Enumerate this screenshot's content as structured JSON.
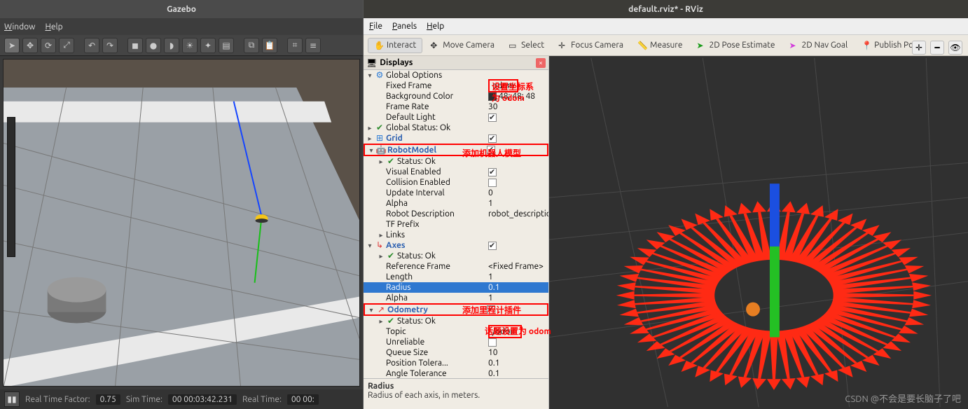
{
  "gazebo": {
    "title": "Gazebo",
    "menu": {
      "window": "Window",
      "help": "Help"
    },
    "status": {
      "rtf_label": "Real Time Factor:",
      "rtf_value": "0.75",
      "simtime_label": "Sim Time:",
      "simtime_value": "00 00:03:42.231",
      "realtime_label": "Real Time:",
      "realtime_value": "00 00:"
    }
  },
  "rviz": {
    "title": "default.rviz* - RViz",
    "menu": {
      "file": "File",
      "panels": "Panels",
      "help": "Help"
    },
    "toolbar": {
      "interact": "Interact",
      "move_camera": "Move Camera",
      "select": "Select",
      "focus_camera": "Focus Camera",
      "measure": "Measure",
      "pose_estimate": "2D Pose Estimate",
      "nav_goal": "2D Nav Goal",
      "publish_point": "Publish Point"
    },
    "panel_title": "Displays",
    "tree": {
      "global_options": "Global Options",
      "fixed_frame": "Fixed Frame",
      "fixed_frame_v": "odom",
      "bg_color": "Background Color",
      "bg_color_v": "48; 48; 48",
      "frame_rate": "Frame Rate",
      "frame_rate_v": "30",
      "default_light": "Default Light",
      "global_status": "Global Status: Ok",
      "grid": "Grid",
      "robot_model": "RobotModel",
      "status_ok": "Status: Ok",
      "visual_enabled": "Visual Enabled",
      "collision_enabled": "Collision Enabled",
      "update_interval": "Update Interval",
      "update_interval_v": "0",
      "alpha": "Alpha",
      "alpha_v": "1",
      "robot_desc": "Robot Description",
      "robot_desc_v": "robot_description",
      "tf_prefix": "TF Prefix",
      "links": "Links",
      "axes": "Axes",
      "ref_frame": "Reference Frame",
      "ref_frame_v": "<Fixed Frame>",
      "length": "Length",
      "length_v": "1",
      "radius": "Radius",
      "radius_v": "0.1",
      "alpha2": "Alpha",
      "alpha2_v": "1",
      "odometry": "Odometry",
      "topic": "Topic",
      "topic_v": "/odom",
      "unreliable": "Unreliable",
      "queue_size": "Queue Size",
      "queue_size_v": "10",
      "pos_tol": "Position Tolera...",
      "pos_tol_v": "0.1",
      "ang_tol": "Angle Tolerance",
      "ang_tol_v": "0.1"
    },
    "desc": {
      "title": "Radius",
      "body": "Radius of each axis, in meters."
    },
    "anno": {
      "set_frame": "设置坐标系",
      "to_odom": "为 odom",
      "add_robot": "添加机器人模型",
      "add_odom": "添加里程计插件",
      "topic_odom": "话题设置为 odom"
    }
  },
  "watermark": "CSDN @不会是要长脑子了吧",
  "colors": {
    "accent_red": "#ff3b30",
    "rviz_sel": "#2f78d0"
  }
}
